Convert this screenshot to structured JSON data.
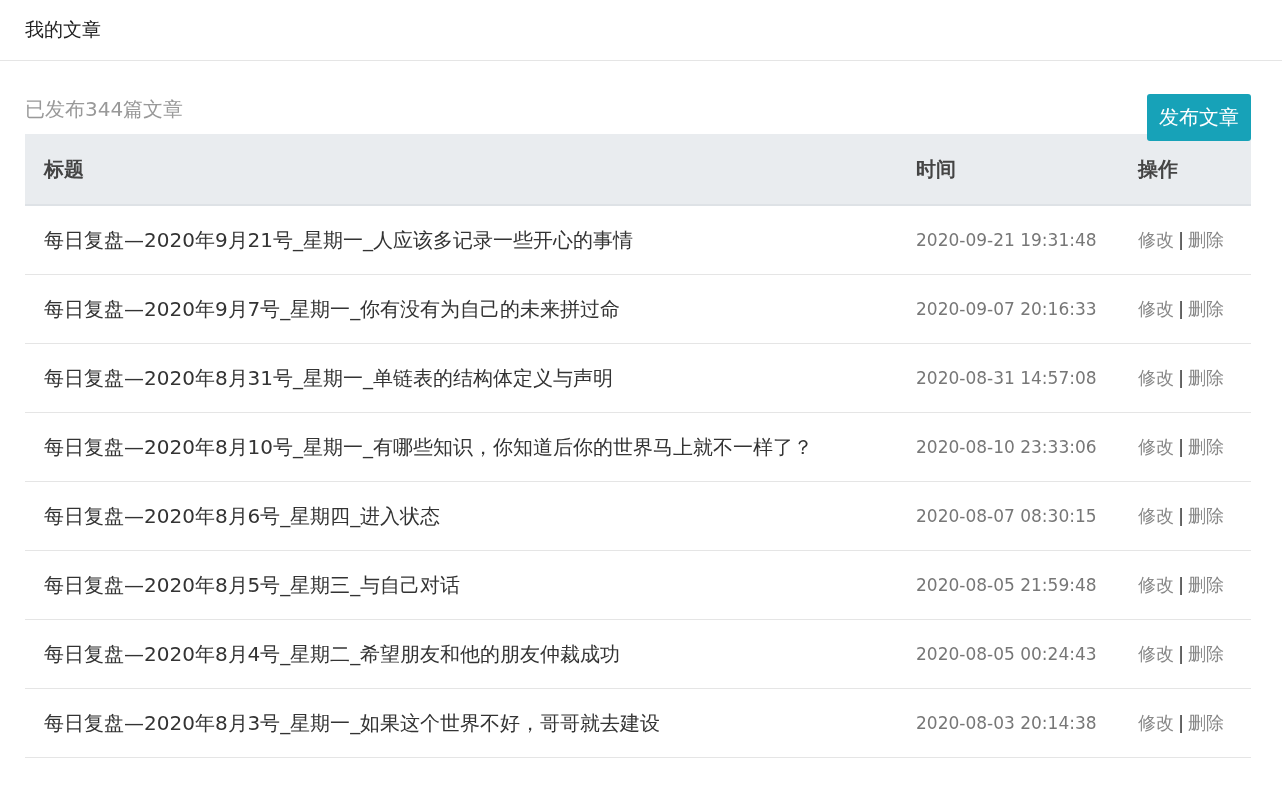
{
  "header": {
    "title": "我的文章"
  },
  "summary": "已发布344篇文章",
  "publish_button": "发布文章",
  "table": {
    "columns": [
      "标题",
      "时间",
      "操作"
    ],
    "rows": [
      {
        "title": "每日复盘—2020年9月21号_星期一_人应该多记录一些开心的事情",
        "time": "2020-09-21 19:31:48",
        "edit": "修改",
        "separator": "|",
        "delete": "删除"
      },
      {
        "title": "每日复盘—2020年9月7号_星期一_你有没有为自己的未来拼过命",
        "time": "2020-09-07 20:16:33",
        "edit": "修改",
        "separator": "|",
        "delete": "删除"
      },
      {
        "title": "每日复盘—2020年8月31号_星期一_单链表的结构体定义与声明",
        "time": "2020-08-31 14:57:08",
        "edit": "修改",
        "separator": "|",
        "delete": "删除"
      },
      {
        "title": "每日复盘—2020年8月10号_星期一_有哪些知识，你知道后你的世界马上就不一样了？",
        "time": "2020-08-10 23:33:06",
        "edit": "修改",
        "separator": "|",
        "delete": "删除"
      },
      {
        "title": "每日复盘—2020年8月6号_星期四_进入状态",
        "time": "2020-08-07 08:30:15",
        "edit": "修改",
        "separator": "|",
        "delete": "删除"
      },
      {
        "title": "每日复盘—2020年8月5号_星期三_与自己对话",
        "time": "2020-08-05 21:59:48",
        "edit": "修改",
        "separator": "|",
        "delete": "删除"
      },
      {
        "title": "每日复盘—2020年8月4号_星期二_希望朋友和他的朋友仲裁成功",
        "time": "2020-08-05 00:24:43",
        "edit": "修改",
        "separator": "|",
        "delete": "删除"
      },
      {
        "title": "每日复盘—2020年8月3号_星期一_如果这个世界不好，哥哥就去建设",
        "time": "2020-08-03 20:14:38",
        "edit": "修改",
        "separator": "|",
        "delete": "删除"
      }
    ]
  }
}
